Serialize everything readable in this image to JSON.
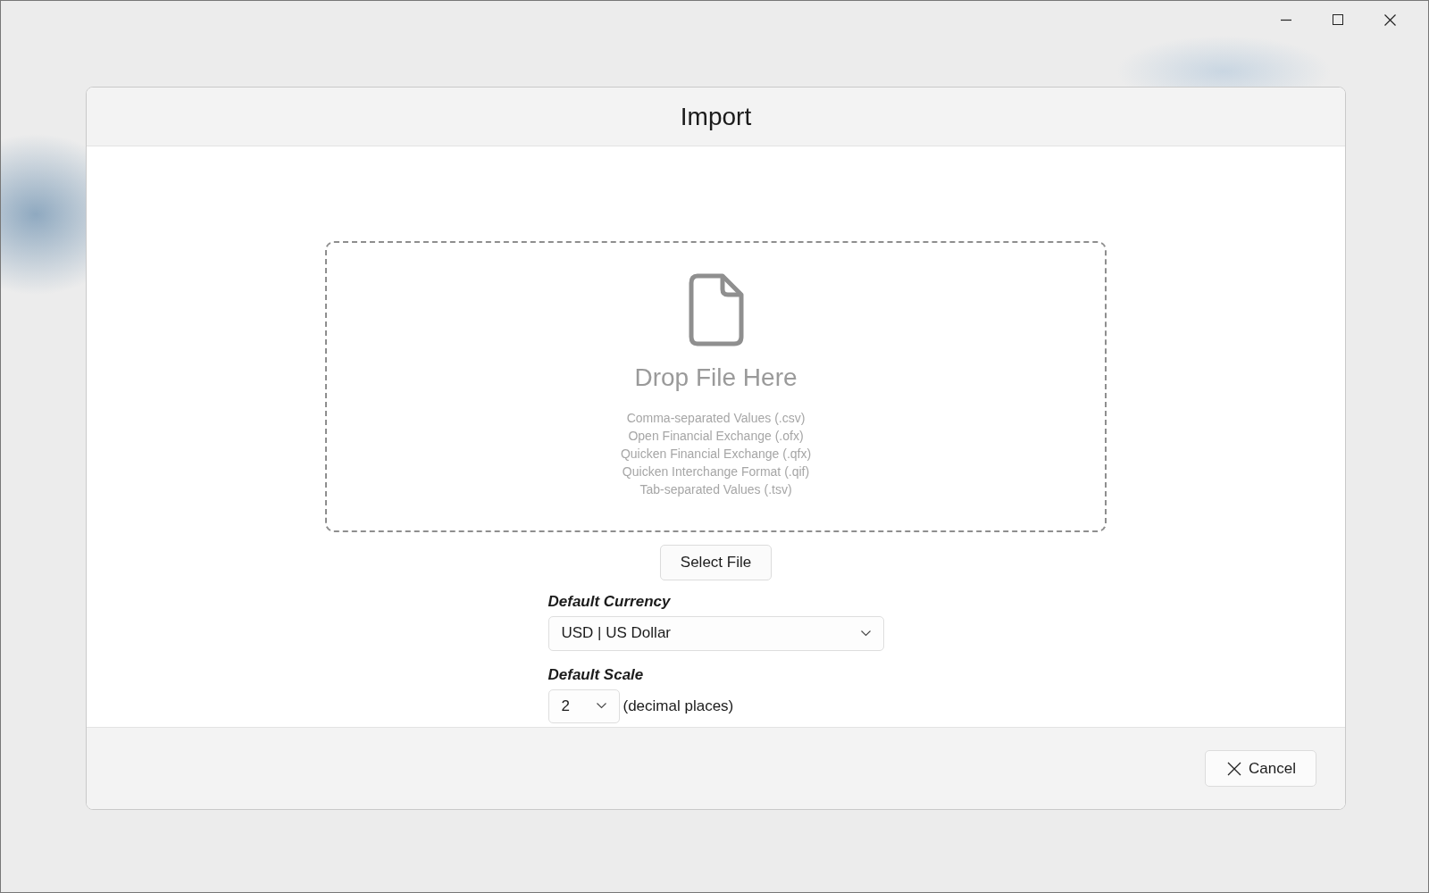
{
  "dialog": {
    "title": "Import"
  },
  "drop_zone": {
    "heading": "Drop File Here",
    "formats": [
      "Comma-separated Values (.csv)",
      "Open Financial Exchange (.ofx)",
      "Quicken Financial Exchange (.qfx)",
      "Quicken Interchange Format (.qif)",
      "Tab-separated Values (.tsv)"
    ]
  },
  "select_button": "Select File",
  "currency": {
    "label": "Default Currency",
    "value": "USD | US Dollar"
  },
  "scale": {
    "label": "Default Scale",
    "value": "2",
    "suffix": "(decimal places)"
  },
  "footer": {
    "cancel_button": "Cancel"
  }
}
